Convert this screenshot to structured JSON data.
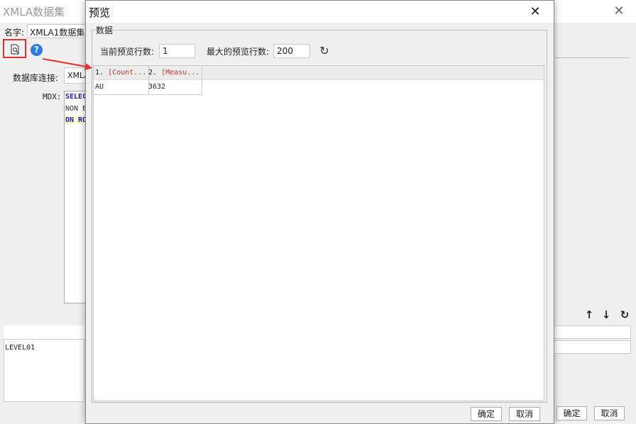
{
  "background": {
    "title": "XMLA数据集",
    "name_label": "名字:",
    "name_value": "XMLA1数据集",
    "db_label": "数据库连接:",
    "db_value": "XMLA",
    "mdx_label": "MDX:",
    "mdx_lines": [
      "SELECT",
      "NON E",
      "ON RO"
    ],
    "level_item": "LEVEL01",
    "ok_label": "确定",
    "cancel_label": "取消",
    "icons": {
      "preview": "preview-icon",
      "help": "help-icon",
      "up": "arrow-up-icon",
      "down": "arrow-down-icon",
      "refresh": "refresh-icon"
    },
    "help_glyph": "?",
    "close_glyph": "✕",
    "up_glyph": "↑",
    "down_glyph": "↓",
    "refresh_glyph": "↻"
  },
  "dialog": {
    "title": "预览",
    "close_glyph": "✕",
    "group_title": "数据",
    "current_rows_label": "当前预览行数:",
    "current_rows_value": "1",
    "max_rows_label": "最大的预览行数:",
    "max_rows_value": "200",
    "refresh_glyph": "↻",
    "table": {
      "columns": [
        {
          "index": "1.",
          "name": "[Count..."
        },
        {
          "index": "2.",
          "name": "[Measu..."
        }
      ],
      "rows": [
        [
          "AU",
          "3632"
        ]
      ]
    },
    "ok_label": "确定",
    "cancel_label": "取消"
  },
  "colors": {
    "highlight": "#e8302c",
    "help_blue": "#2f7ae5",
    "keyword_blue": "#1a1ab8"
  }
}
